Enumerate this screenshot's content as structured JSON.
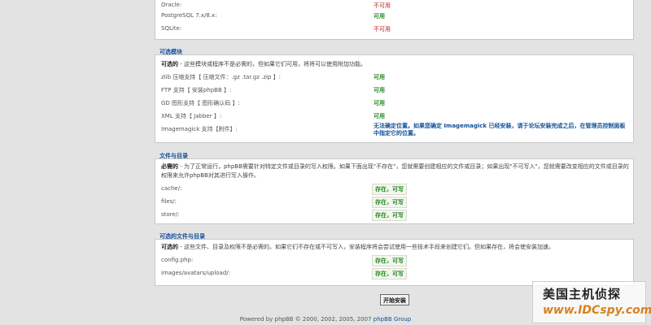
{
  "db_panel": {
    "rows": [
      {
        "label": "Oracle:",
        "value": "不可用",
        "status": "bad"
      },
      {
        "label": "PostgreSQL 7.x/8.x:",
        "value": "可用",
        "status": "ok"
      },
      {
        "label": "SQLite:",
        "value": "不可用",
        "status": "bad"
      }
    ]
  },
  "optional_modules": {
    "title": "可选模块",
    "intro_strong": "可选的",
    "intro": " - 这些模块或程序不是必需的，但如果它们可用，将将可以使用附加功能。",
    "rows": [
      {
        "label": "zlib 压缩支持【 压缩文件：.gz .tar.gz .zip 】:",
        "value": "可用",
        "status": "ok"
      },
      {
        "label": "FTP 支持【 安装phpBB 】:",
        "value": "可用",
        "status": "ok"
      },
      {
        "label": "GD 图形支持【 图形确认码 】:",
        "value": "可用",
        "status": "ok"
      },
      {
        "label": "XML 支持【 Jabber 】:",
        "value": "可用",
        "status": "ok"
      },
      {
        "label": "Imagemagick 支持【附件】:",
        "value": "无法确定位置。如果您确定 Imagemagick 已经安装，请于论坛安装完成之后，在管理员控制面板中指定它的位置。",
        "status": "note"
      }
    ]
  },
  "files_dirs": {
    "title": "文件与目录",
    "intro_strong": "必需的",
    "intro": " - 为了正常运行，phpBB需要针对特定文件或目录的写入权限。如果下面出现\"不存在\"，您就需要创建相应的文件或目录；如果出现\"不可写入\"，您就需要改变相应的文件或目录的权限来允许phpBB对其进行写入操作。",
    "rows": [
      {
        "label": "cache/:",
        "value": "存在，可写"
      },
      {
        "label": "files/:",
        "value": "存在，可写"
      },
      {
        "label": "store/:",
        "value": "存在，可写"
      }
    ]
  },
  "optional_files": {
    "title": "可选的文件与目录",
    "intro_strong": "可选的",
    "intro": " - 这些文件、目录及权限不是必需的。如果它们不存在或不可写入，安装程序将会尝试使用一些技术手段来创建它们。但如果存在，将会使安装加速。",
    "rows": [
      {
        "label": "config.php:",
        "value": "存在，可写"
      },
      {
        "label": "images/avatars/upload/:",
        "value": "存在，可写"
      }
    ]
  },
  "install_button": "开始安装",
  "footer": {
    "text": "Powered by phpBB © 2000, 2002, 2005, 2007 ",
    "link": "phpBB Group"
  },
  "watermark": {
    "line1": "美国主机侦探",
    "line2": "www.IDCspy.com"
  }
}
